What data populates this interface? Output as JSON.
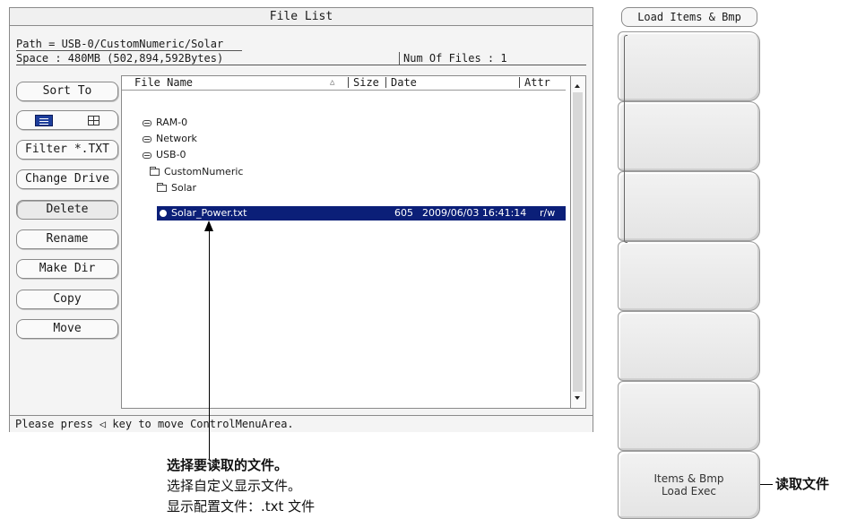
{
  "dialog": {
    "title": "File List",
    "path": "Path = USB-0/CustomNumeric/Solar",
    "space": "Space : 480MB (502,894,592Bytes)",
    "num_files": "Num Of Files : 1",
    "status": "Please press ◁ key to move ControlMenuArea."
  },
  "buttons": {
    "sort": "Sort To",
    "filter": "Filter *.TXT",
    "change_drive": "Change Drive",
    "delete": "Delete",
    "rename": "Rename",
    "make_dir": "Make Dir",
    "copy": "Copy",
    "move": "Move"
  },
  "columns": {
    "name": "File Name",
    "sort_indicator": "△",
    "size": "Size",
    "date": "Date",
    "attr": "Attr"
  },
  "tree": [
    {
      "label": "RAM-0",
      "icon": "drive-icon"
    },
    {
      "label": "Network",
      "icon": "drive-icon"
    },
    {
      "label": "USB-0",
      "icon": "drive-icon"
    },
    {
      "label": "CustomNumeric",
      "icon": "folder-icon"
    },
    {
      "label": "Solar",
      "icon": "folder-icon"
    }
  ],
  "selected_file": {
    "name": "Solar_Power.txt",
    "size": "605",
    "date": "2009/06/03 16:41:14",
    "attr": "r/w",
    "icon": "file-icon",
    "highlight_color": "#0b1f78"
  },
  "annotation": {
    "line1": "选择要读取的文件。",
    "line2": "选择自定义显示文件。",
    "line3": "显示配置文件：.txt 文件"
  },
  "softkeys": {
    "title": "Load Items & Bmp",
    "exec_line1": "Items & Bmp",
    "exec_line2": "Load Exec",
    "callout": "读取文件"
  }
}
